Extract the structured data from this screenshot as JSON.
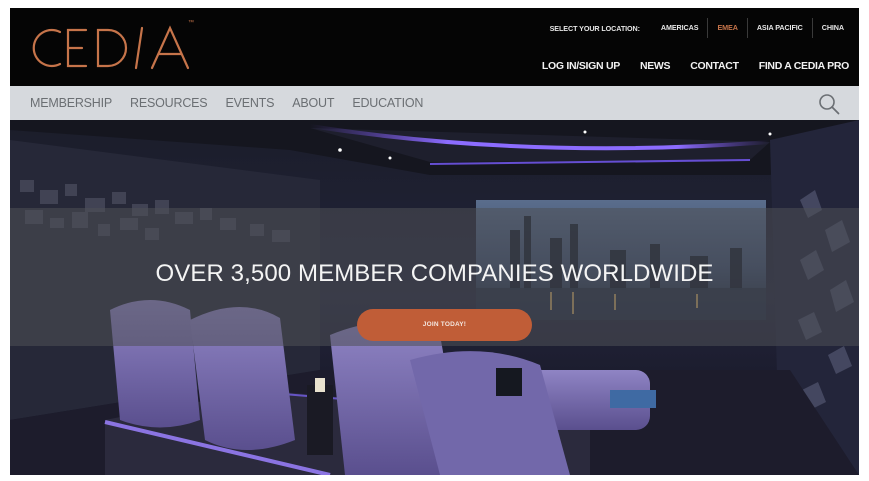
{
  "brand": {
    "logo_text": "CEDIA",
    "trademark": "™",
    "accent_color": "#c6744a"
  },
  "location": {
    "label": "SELECT YOUR LOCATION:",
    "items": [
      {
        "label": "AMERICAS"
      },
      {
        "label": "EMEA"
      },
      {
        "label": "ASIA PACIFIC"
      },
      {
        "label": "CHINA"
      }
    ],
    "active": "EMEA"
  },
  "top_links": [
    {
      "label": "LOG IN/SIGN UP"
    },
    {
      "label": "NEWS"
    },
    {
      "label": "CONTACT"
    },
    {
      "label": "FIND A CEDIA PRO"
    }
  ],
  "nav": {
    "items": [
      {
        "label": "MEMBERSHIP"
      },
      {
        "label": "RESOURCES"
      },
      {
        "label": "EVENTS"
      },
      {
        "label": "ABOUT"
      },
      {
        "label": "EDUCATION"
      }
    ],
    "search_icon": "search-icon"
  },
  "hero": {
    "headline": "OVER 3,500 MEMBER COMPANIES WORLDWIDE",
    "cta_label": "JOIN TODAY!",
    "cta_color": "#c05d37"
  }
}
